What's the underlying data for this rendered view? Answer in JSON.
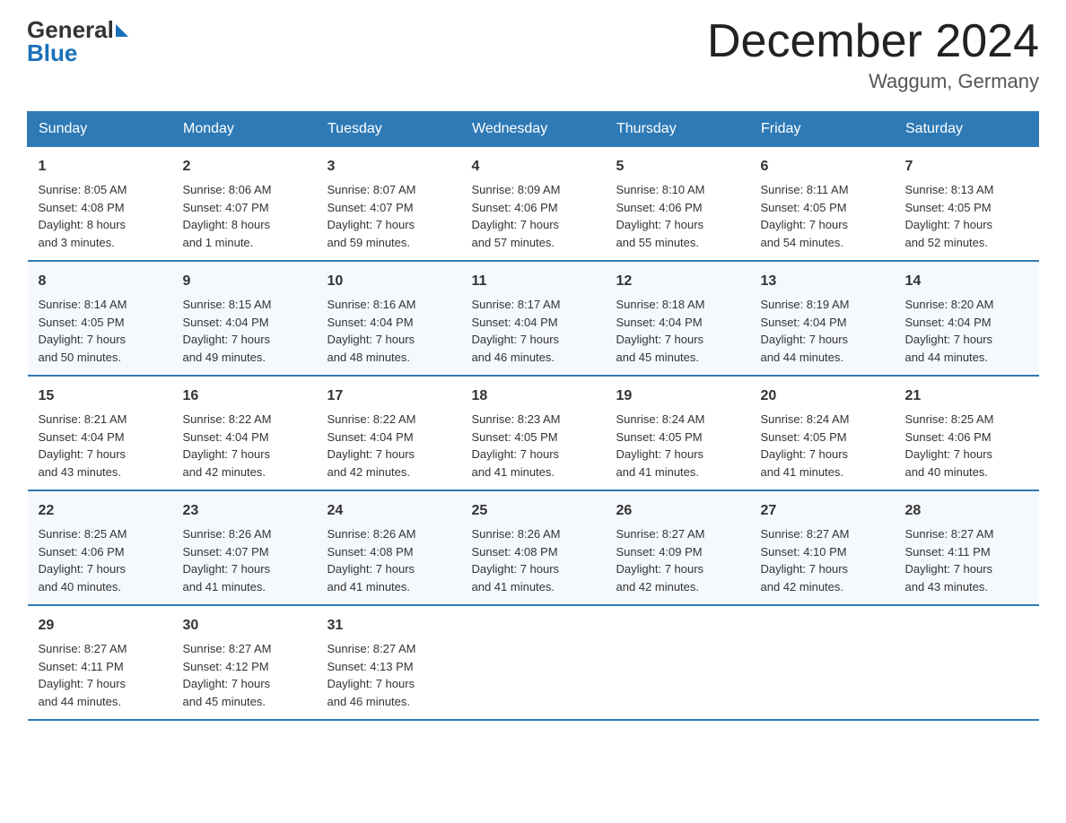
{
  "logo": {
    "text_general": "General",
    "text_blue": "Blue",
    "arrow_color": "#1a6fba"
  },
  "header": {
    "title": "December 2024",
    "location": "Waggum, Germany"
  },
  "days_of_week": [
    "Sunday",
    "Monday",
    "Tuesday",
    "Wednesday",
    "Thursday",
    "Friday",
    "Saturday"
  ],
  "weeks": [
    [
      {
        "day": "1",
        "detail": "Sunrise: 8:05 AM\nSunset: 4:08 PM\nDaylight: 8 hours\nand 3 minutes."
      },
      {
        "day": "2",
        "detail": "Sunrise: 8:06 AM\nSunset: 4:07 PM\nDaylight: 8 hours\nand 1 minute."
      },
      {
        "day": "3",
        "detail": "Sunrise: 8:07 AM\nSunset: 4:07 PM\nDaylight: 7 hours\nand 59 minutes."
      },
      {
        "day": "4",
        "detail": "Sunrise: 8:09 AM\nSunset: 4:06 PM\nDaylight: 7 hours\nand 57 minutes."
      },
      {
        "day": "5",
        "detail": "Sunrise: 8:10 AM\nSunset: 4:06 PM\nDaylight: 7 hours\nand 55 minutes."
      },
      {
        "day": "6",
        "detail": "Sunrise: 8:11 AM\nSunset: 4:05 PM\nDaylight: 7 hours\nand 54 minutes."
      },
      {
        "day": "7",
        "detail": "Sunrise: 8:13 AM\nSunset: 4:05 PM\nDaylight: 7 hours\nand 52 minutes."
      }
    ],
    [
      {
        "day": "8",
        "detail": "Sunrise: 8:14 AM\nSunset: 4:05 PM\nDaylight: 7 hours\nand 50 minutes."
      },
      {
        "day": "9",
        "detail": "Sunrise: 8:15 AM\nSunset: 4:04 PM\nDaylight: 7 hours\nand 49 minutes."
      },
      {
        "day": "10",
        "detail": "Sunrise: 8:16 AM\nSunset: 4:04 PM\nDaylight: 7 hours\nand 48 minutes."
      },
      {
        "day": "11",
        "detail": "Sunrise: 8:17 AM\nSunset: 4:04 PM\nDaylight: 7 hours\nand 46 minutes."
      },
      {
        "day": "12",
        "detail": "Sunrise: 8:18 AM\nSunset: 4:04 PM\nDaylight: 7 hours\nand 45 minutes."
      },
      {
        "day": "13",
        "detail": "Sunrise: 8:19 AM\nSunset: 4:04 PM\nDaylight: 7 hours\nand 44 minutes."
      },
      {
        "day": "14",
        "detail": "Sunrise: 8:20 AM\nSunset: 4:04 PM\nDaylight: 7 hours\nand 44 minutes."
      }
    ],
    [
      {
        "day": "15",
        "detail": "Sunrise: 8:21 AM\nSunset: 4:04 PM\nDaylight: 7 hours\nand 43 minutes."
      },
      {
        "day": "16",
        "detail": "Sunrise: 8:22 AM\nSunset: 4:04 PM\nDaylight: 7 hours\nand 42 minutes."
      },
      {
        "day": "17",
        "detail": "Sunrise: 8:22 AM\nSunset: 4:04 PM\nDaylight: 7 hours\nand 42 minutes."
      },
      {
        "day": "18",
        "detail": "Sunrise: 8:23 AM\nSunset: 4:05 PM\nDaylight: 7 hours\nand 41 minutes."
      },
      {
        "day": "19",
        "detail": "Sunrise: 8:24 AM\nSunset: 4:05 PM\nDaylight: 7 hours\nand 41 minutes."
      },
      {
        "day": "20",
        "detail": "Sunrise: 8:24 AM\nSunset: 4:05 PM\nDaylight: 7 hours\nand 41 minutes."
      },
      {
        "day": "21",
        "detail": "Sunrise: 8:25 AM\nSunset: 4:06 PM\nDaylight: 7 hours\nand 40 minutes."
      }
    ],
    [
      {
        "day": "22",
        "detail": "Sunrise: 8:25 AM\nSunset: 4:06 PM\nDaylight: 7 hours\nand 40 minutes."
      },
      {
        "day": "23",
        "detail": "Sunrise: 8:26 AM\nSunset: 4:07 PM\nDaylight: 7 hours\nand 41 minutes."
      },
      {
        "day": "24",
        "detail": "Sunrise: 8:26 AM\nSunset: 4:08 PM\nDaylight: 7 hours\nand 41 minutes."
      },
      {
        "day": "25",
        "detail": "Sunrise: 8:26 AM\nSunset: 4:08 PM\nDaylight: 7 hours\nand 41 minutes."
      },
      {
        "day": "26",
        "detail": "Sunrise: 8:27 AM\nSunset: 4:09 PM\nDaylight: 7 hours\nand 42 minutes."
      },
      {
        "day": "27",
        "detail": "Sunrise: 8:27 AM\nSunset: 4:10 PM\nDaylight: 7 hours\nand 42 minutes."
      },
      {
        "day": "28",
        "detail": "Sunrise: 8:27 AM\nSunset: 4:11 PM\nDaylight: 7 hours\nand 43 minutes."
      }
    ],
    [
      {
        "day": "29",
        "detail": "Sunrise: 8:27 AM\nSunset: 4:11 PM\nDaylight: 7 hours\nand 44 minutes."
      },
      {
        "day": "30",
        "detail": "Sunrise: 8:27 AM\nSunset: 4:12 PM\nDaylight: 7 hours\nand 45 minutes."
      },
      {
        "day": "31",
        "detail": "Sunrise: 8:27 AM\nSunset: 4:13 PM\nDaylight: 7 hours\nand 46 minutes."
      },
      {
        "day": "",
        "detail": ""
      },
      {
        "day": "",
        "detail": ""
      },
      {
        "day": "",
        "detail": ""
      },
      {
        "day": "",
        "detail": ""
      }
    ]
  ]
}
